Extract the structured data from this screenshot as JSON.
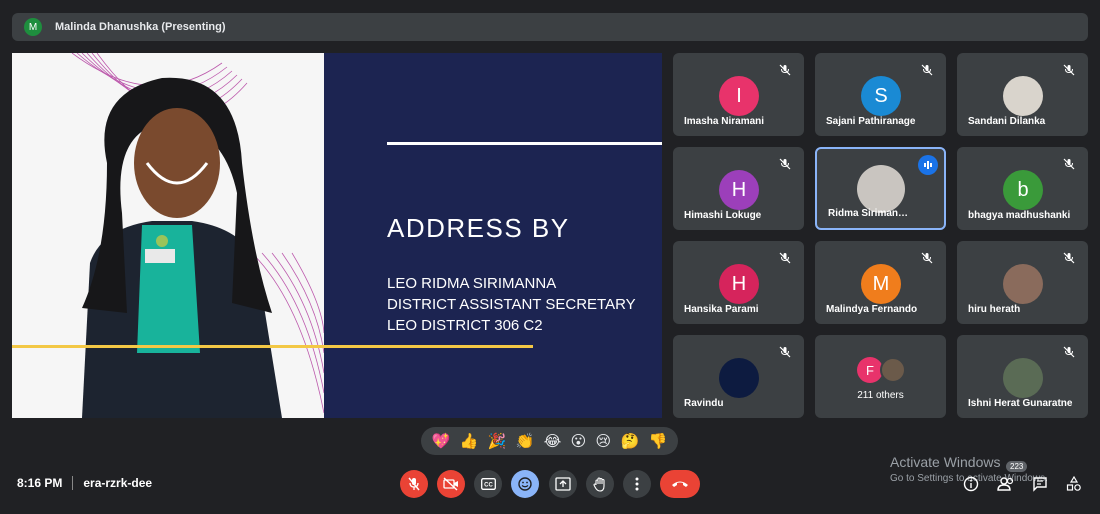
{
  "presenter_bar": {
    "avatar_initial": "M",
    "label": "Malinda Dhanushka (Presenting)"
  },
  "slide": {
    "title": "ADDRESS BY",
    "lines": [
      "LEO RIDMA SIRIMANNA",
      "DISTRICT ASSISTANT SECRETARY",
      "LEO DISTRICT 306 C2"
    ]
  },
  "participants": [
    {
      "name": "Imasha Niramani",
      "initial": "I",
      "color": "#e8336b",
      "muted": true
    },
    {
      "name": "Sajani Pathiranage",
      "initial": "S",
      "color": "#1a8ad4",
      "muted": true
    },
    {
      "name": "Sandani Dilanka",
      "initial": "",
      "color": "#d9d4cc",
      "muted": true
    },
    {
      "name": "Himashi Lokuge",
      "initial": "H",
      "color": "#9c3fba",
      "muted": true
    },
    {
      "name": "Ridma Siriman…",
      "initial": "",
      "color": "#c9c5c0",
      "muted": false,
      "speaking": true
    },
    {
      "name": "bhagya madhushanki",
      "initial": "b",
      "color": "#3a9a3a",
      "muted": true
    },
    {
      "name": "Hansika Parami",
      "initial": "H",
      "color": "#d6245c",
      "muted": true
    },
    {
      "name": "Malindya Fernando",
      "initial": "M",
      "color": "#f07d1c",
      "muted": true
    },
    {
      "name": "hiru herath",
      "initial": "",
      "color": "#8a6b5c",
      "muted": true
    },
    {
      "name": "Ravindu",
      "initial": "",
      "color": "#0d1b40",
      "muted": true
    },
    {
      "name": "211 others",
      "initial": "F",
      "color": "#e8336b",
      "muted": false,
      "others": true
    },
    {
      "name": "Ishni Herat Gunaratne",
      "initial": "",
      "color": "#5a6b55",
      "muted": true
    }
  ],
  "reactions": [
    "💖",
    "👍",
    "🎉",
    "👏",
    "😂",
    "😮",
    "😢",
    "🤔",
    "👎"
  ],
  "meeting": {
    "time": "8:16 PM",
    "code": "era-rzrk-dee"
  },
  "watermark": {
    "line1": "Activate Windows",
    "line2": "Go to Settings to activate Windows."
  },
  "people_count": "223",
  "controls": {
    "mic": "mic-off-icon",
    "camera": "camera-off-icon",
    "captions": "captions-icon",
    "emoji": "emoji-icon",
    "present": "present-icon",
    "hand": "raise-hand-icon",
    "more": "more-icon",
    "end": "end-call-icon"
  }
}
